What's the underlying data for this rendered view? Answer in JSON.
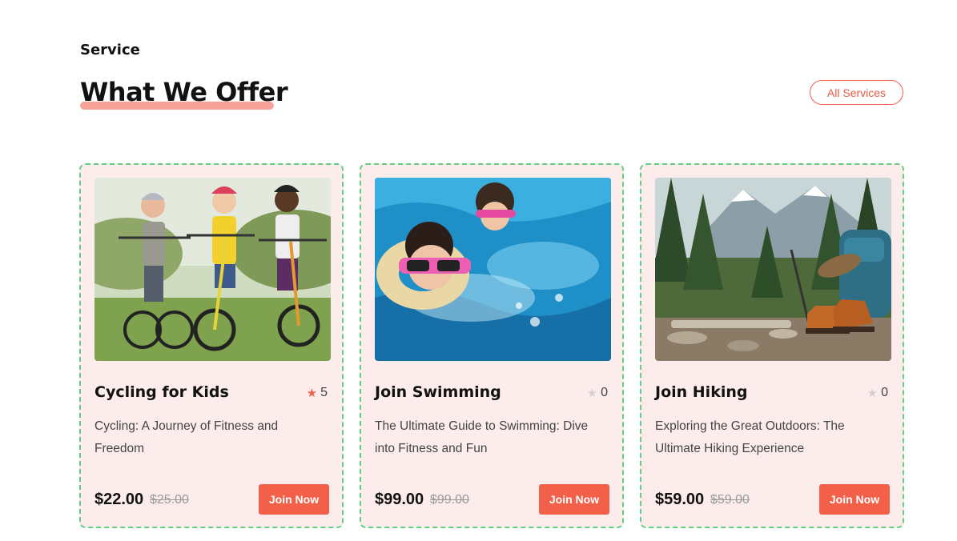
{
  "section": {
    "eyebrow": "Service",
    "title": "What We Offer",
    "all_services_label": "All Services"
  },
  "cards": [
    {
      "name": "Cycling for Kids",
      "rating": "5",
      "rating_active": true,
      "description": "Cycling: A Journey of Fitness and Freedom",
      "price": "$22.00",
      "old_price": "$25.00",
      "button_label": "Join Now",
      "image": "kids-cycling-photo"
    },
    {
      "name": "Join Swimming",
      "rating": "0",
      "rating_active": false,
      "description": "The Ultimate Guide to Swimming: Dive into Fitness and Fun",
      "price": "$99.00",
      "old_price": "$99.00",
      "button_label": "Join Now",
      "image": "kids-swimming-photo"
    },
    {
      "name": "Join Hiking",
      "rating": "0",
      "rating_active": false,
      "description": "Exploring the Great Outdoors: The Ultimate Hiking Experience",
      "price": "$59.00",
      "old_price": "$59.00",
      "button_label": "Join Now",
      "image": "hiking-gear-photo"
    }
  ],
  "colors": {
    "accent": "#f2604a",
    "card_bg": "#fcecec",
    "card_border": "#5fd082",
    "underline": "#f7a39a"
  }
}
